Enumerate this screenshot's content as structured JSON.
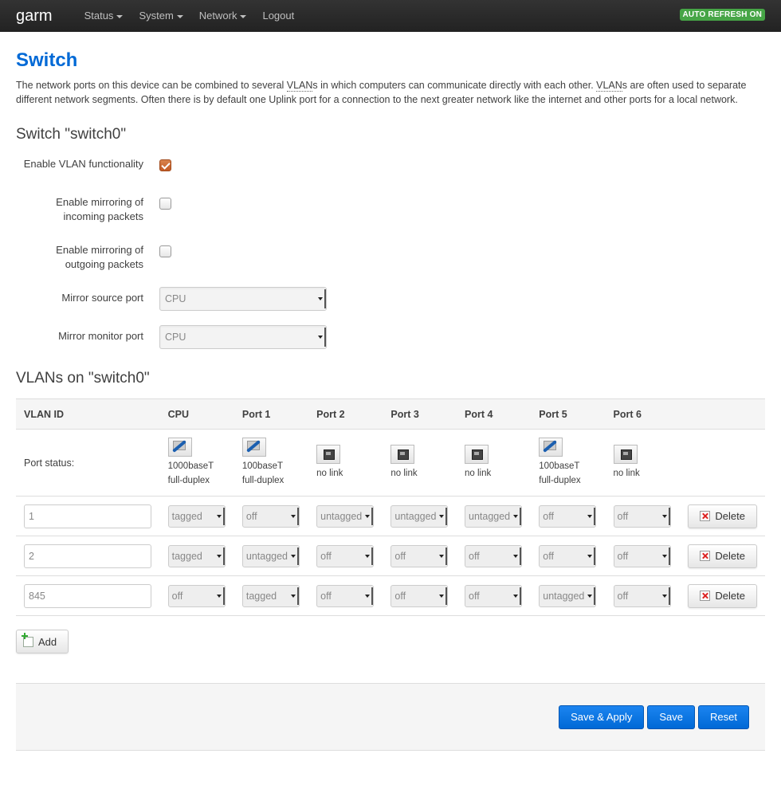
{
  "navbar": {
    "brand": "garm",
    "menu": [
      {
        "label": "Status",
        "dropdown": true
      },
      {
        "label": "System",
        "dropdown": true
      },
      {
        "label": "Network",
        "dropdown": true
      },
      {
        "label": "Logout",
        "dropdown": false
      }
    ],
    "refresh_badge": "AUTO REFRESH ON"
  },
  "page": {
    "title": "Switch",
    "desc_1": "The network ports on this device can be combined to several ",
    "desc_vlans_1": "VLAN",
    "desc_2": "s in which computers can communicate directly with each other. ",
    "desc_vlans_2": "VLAN",
    "desc_3": "s are often used to separate different network segments. Often there is by default one Uplink port for a connection to the next greater network like the internet and other ports for a local network."
  },
  "switch_section": {
    "title": "Switch \"switch0\"",
    "enable_vlan_label": "Enable VLAN functionality",
    "enable_vlan_checked": true,
    "mirror_in_label": "Enable mirroring of incoming packets",
    "mirror_in_checked": false,
    "mirror_out_label": "Enable mirroring of outgoing packets",
    "mirror_out_checked": false,
    "mirror_source_label": "Mirror source port",
    "mirror_source_value": "CPU",
    "mirror_monitor_label": "Mirror monitor port",
    "mirror_monitor_value": "CPU"
  },
  "vlan_section": {
    "title": "VLANs on \"switch0\"",
    "headers": [
      "VLAN ID",
      "CPU",
      "Port 1",
      "Port 2",
      "Port 3",
      "Port 4",
      "Port 5",
      "Port 6"
    ],
    "port_status_label": "Port status:",
    "port_status": [
      {
        "link": "up",
        "line1": "1000baseT",
        "line2": "full-duplex"
      },
      {
        "link": "up",
        "line1": "100baseT",
        "line2": "full-duplex"
      },
      {
        "link": "down",
        "line1": "no link",
        "line2": ""
      },
      {
        "link": "down",
        "line1": "no link",
        "line2": ""
      },
      {
        "link": "down",
        "line1": "no link",
        "line2": ""
      },
      {
        "link": "up",
        "line1": "100baseT",
        "line2": "full-duplex"
      },
      {
        "link": "down",
        "line1": "no link",
        "line2": ""
      }
    ],
    "rows": [
      {
        "id": "1",
        "ports": [
          "tagged",
          "off",
          "untagged",
          "untagged",
          "untagged",
          "off",
          "off"
        ]
      },
      {
        "id": "2",
        "ports": [
          "tagged",
          "untagged",
          "off",
          "off",
          "off",
          "off",
          "off"
        ]
      },
      {
        "id": "845",
        "ports": [
          "off",
          "tagged",
          "off",
          "off",
          "off",
          "untagged",
          "off"
        ]
      }
    ],
    "delete_label": "Delete",
    "add_label": "Add"
  },
  "footer": {
    "save_apply_label": "Save & Apply",
    "save_label": "Save",
    "reset_label": "Reset"
  }
}
